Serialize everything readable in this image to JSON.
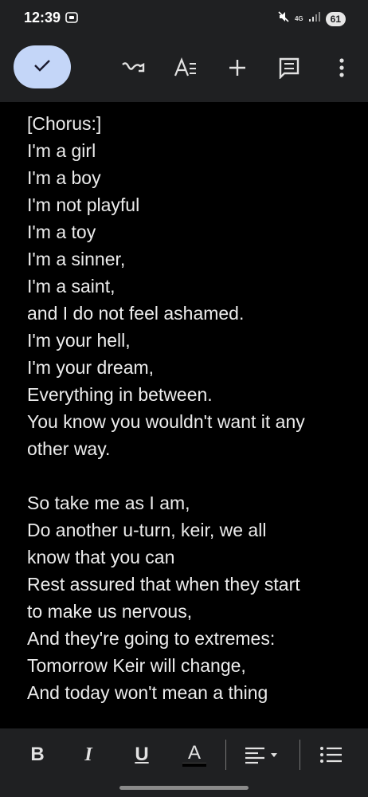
{
  "status_bar": {
    "time": "12:39",
    "network": "4G",
    "battery": "61"
  },
  "toolbar": {
    "icons": [
      "checkmark-icon",
      "handwriting-icon",
      "text-format-icon",
      "add-icon",
      "comment-icon",
      "more-vert-icon"
    ]
  },
  "document": {
    "lines": [
      "[Chorus:]",
      "I'm a girl",
      "I'm a boy",
      "I'm not playful",
      "I'm a toy",
      "I'm a sinner,",
      "I'm a saint,",
      "and I do not feel ashamed.",
      "I'm your hell,",
      "I'm your dream,",
      "Everything in between.",
      "You know you wouldn't want it any",
      "other way.",
      "",
      "So take me as I am,",
      "Do another u-turn, keir, we all",
      "know that you can",
      "Rest assured that when they start",
      "to make us nervous,",
      "And they're going to extremes:",
      "Tomorrow Keir will change,",
      "And today won't mean a thing"
    ]
  },
  "format_bar": {
    "bold": "B",
    "italic": "I",
    "underline": "U",
    "text_color": "A",
    "text_color_swatch": "#000000"
  }
}
